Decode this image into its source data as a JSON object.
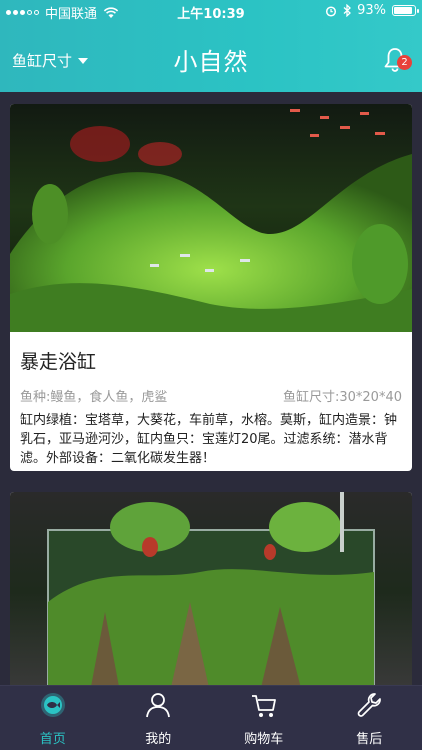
{
  "status_bar": {
    "carrier": "中国联通",
    "time": "上午10:39",
    "battery_pct": "93%",
    "battery_level": 0.93
  },
  "nav": {
    "tank_size_label": "鱼缸尺寸",
    "title": "小自然",
    "notification_count": "2"
  },
  "cards": [
    {
      "title": "暴走浴缸",
      "fish_species": "鱼种:鳗鱼，食人鱼，虎鲨",
      "tank_size": "鱼缸尺寸:30*20*40",
      "description": "缸内绿植：宝塔草，大葵花，车前草，水榕。莫斯，缸内造景：钟乳石，亚马逊河沙，缸内鱼只：宝莲灯20尾。过滤系统：潜水背滤。外部设备：二氧化碳发生器！"
    },
    {}
  ],
  "tabs": [
    {
      "label": "首页",
      "icon": "fish-home-icon",
      "active": true
    },
    {
      "label": "我的",
      "icon": "user-icon",
      "active": false
    },
    {
      "label": "购物车",
      "icon": "cart-icon",
      "active": false
    },
    {
      "label": "售后",
      "icon": "wrench-icon",
      "active": false
    }
  ],
  "colors": {
    "accent": "#2bc3c4",
    "badge": "#e8413a",
    "background": "#2b2b3b",
    "tabbar": "#303047"
  }
}
